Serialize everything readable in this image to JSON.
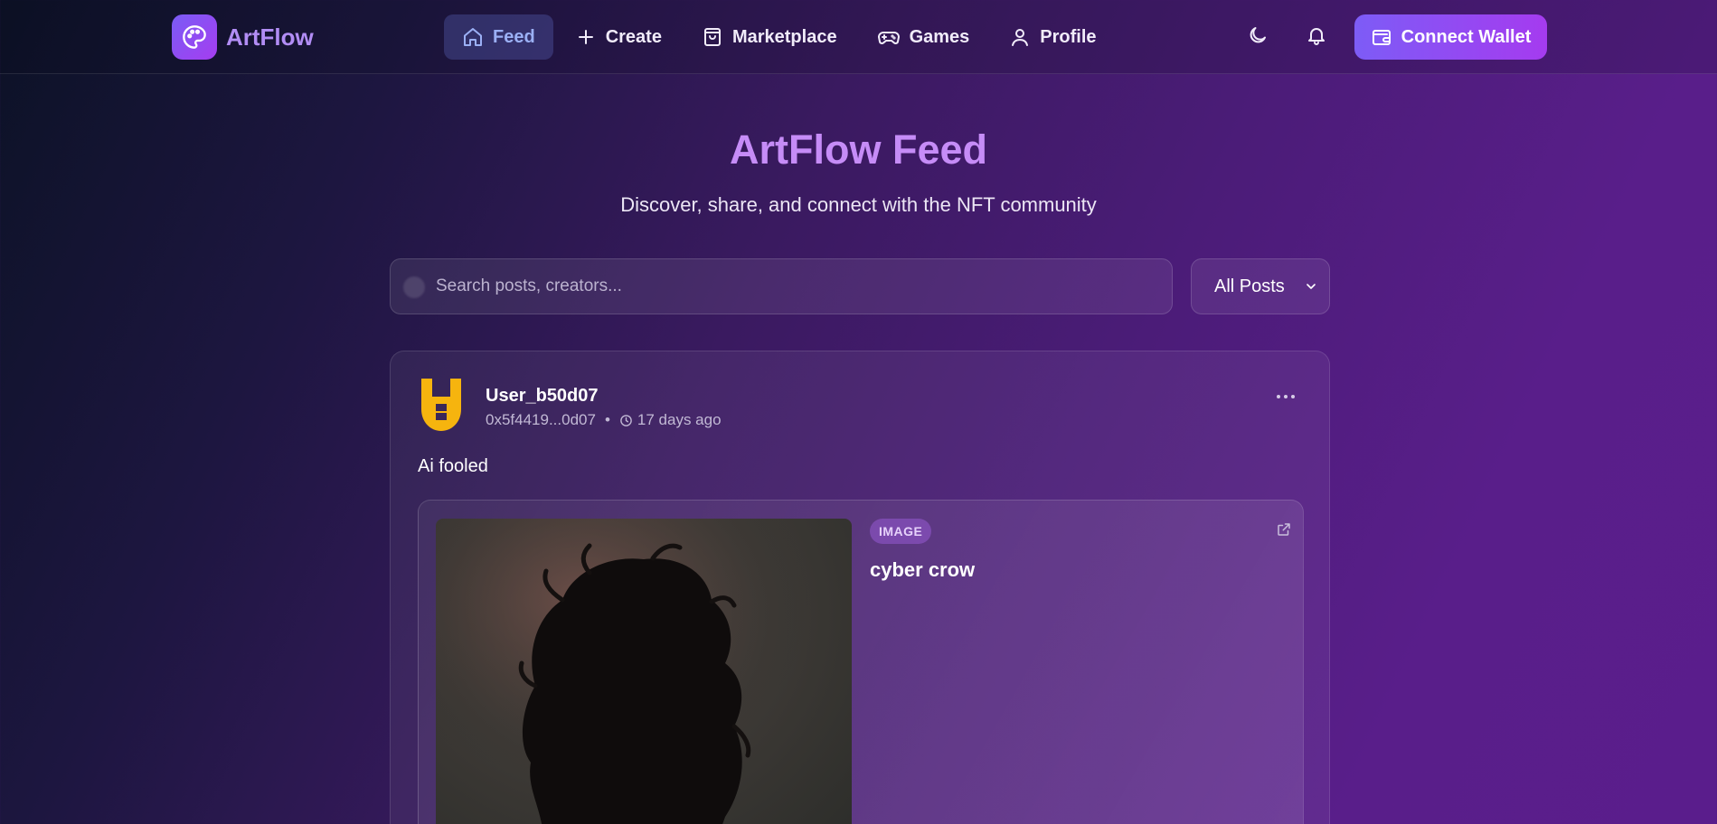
{
  "brand": {
    "name": "ArtFlow",
    "icon": "palette-icon"
  },
  "nav": [
    {
      "label": "Feed",
      "icon": "home-icon",
      "active": true
    },
    {
      "label": "Create",
      "icon": "plus-icon",
      "active": false
    },
    {
      "label": "Marketplace",
      "icon": "shopping-bag-icon",
      "active": false
    },
    {
      "label": "Games",
      "icon": "gamepad-icon",
      "active": false
    },
    {
      "label": "Profile",
      "icon": "user-icon",
      "active": false
    }
  ],
  "header_actions": {
    "theme_icon": "moon-icon",
    "notifications_icon": "bell-icon",
    "wallet_label": "Connect Wallet",
    "wallet_icon": "wallet-icon"
  },
  "hero": {
    "title": "ArtFlow Feed",
    "subtitle": "Discover, share, and connect with the NFT community"
  },
  "search": {
    "placeholder": "Search posts, creators...",
    "value": ""
  },
  "filter": {
    "selected": "All Posts"
  },
  "post": {
    "username": "User_b50d07",
    "address": "0x5f4419...0d07",
    "separator": "•",
    "time": "17 days ago",
    "text": "Ai fooled",
    "nft": {
      "badge": "IMAGE",
      "title": "cyber crow"
    }
  },
  "colors": {
    "accent": "#c68cf7",
    "brand_gradient_start": "#7d5cf6",
    "brand_gradient_end": "#a53bef",
    "avatar": "#f6b40e"
  }
}
